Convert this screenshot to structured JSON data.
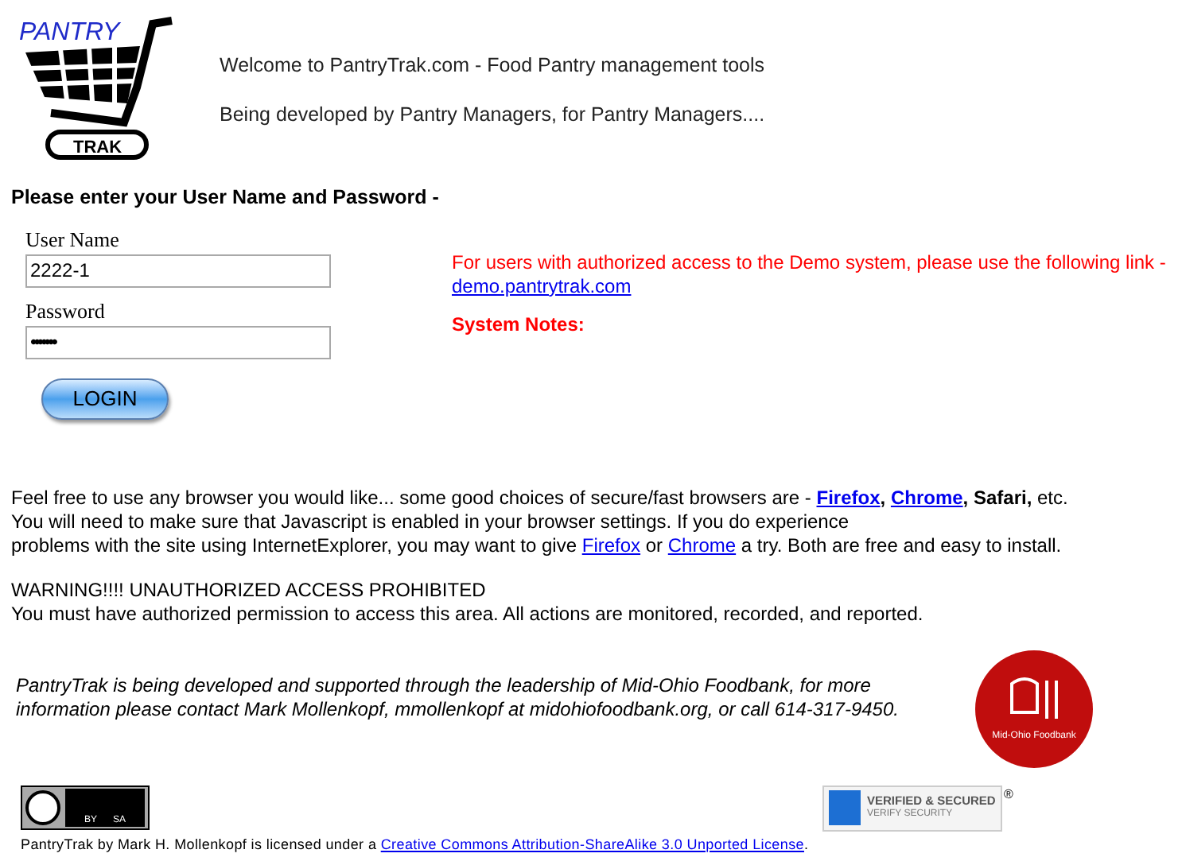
{
  "logo": {
    "top_text": "PANTRY",
    "bottom_text": "TRAK"
  },
  "header": {
    "lines": [
      "Welcome to PantryTrak.com - Food Pantry management tools",
      "Being developed by Pantry Managers, for Pantry Managers...."
    ]
  },
  "login": {
    "heading": "Please enter your User Name and Password -",
    "fields": [
      {
        "label": "User Name",
        "value": "2222-1",
        "kind": "text"
      },
      {
        "label": "Password",
        "value": "•••••••",
        "kind": "password"
      }
    ],
    "button": "LOGIN"
  },
  "demo_notice": {
    "text": "For users with authorized access to the Demo system, please use the following link - ",
    "link": "demo.pantrytrak.com",
    "notes_label": "System Notes:"
  },
  "browser_note": {
    "lines": [
      [
        {
          "kind": "text",
          "text": "Feel free to use any browser you would like... some good choices of secure/fast browsers are - "
        },
        {
          "kind": "link",
          "text": "Firefox",
          "bold": true
        },
        {
          "kind": "text",
          "text": "**,** "
        },
        {
          "kind": "link",
          "text": "Chrome",
          "bold": true
        },
        {
          "kind": "text",
          "text": "**, Safari,** etc."
        }
      ],
      [
        {
          "kind": "text",
          "text": "You will need to make sure that Javascript is enabled in your browser settings. If you do experience"
        }
      ],
      [
        {
          "kind": "text",
          "text": "problems with the site using InternetExplorer, you may want to give "
        },
        {
          "kind": "link",
          "text": "Firefox",
          "bold": false
        },
        {
          "kind": "text",
          "text": " or "
        },
        {
          "kind": "link",
          "text": "Chrome",
          "bold": false
        },
        {
          "kind": "text",
          "text": " a try. Both are free and easy to install."
        }
      ]
    ]
  },
  "warning": {
    "title": "WARNING!!!! UNAUTHORIZED ACCESS PROHIBITED",
    "text": "You must have authorized permission to access this area. All actions are monitored, recorded, and reported."
  },
  "support": {
    "text": "PantryTrak is being developed and supported through the leadership of Mid-Ohio Foodbank, for more information please contact Mark Mollenkopf, mmollenkopf at midohiofoodbank.org, or call 614-317-9450.",
    "badge_text": "Mid-Ohio Foodbank"
  },
  "license": {
    "badge_labels": [
      "BY",
      "SA"
    ],
    "text": "PantryTrak by Mark H. Mollenkopf is licensed under a ",
    "link": "Creative Commons Attribution-ShareAlike 3.0 Unported License",
    "end": "."
  },
  "security_seal": {
    "title": "VERIFIED & SECURED",
    "subtitle": "VERIFY SECURITY",
    "mark": "®"
  }
}
